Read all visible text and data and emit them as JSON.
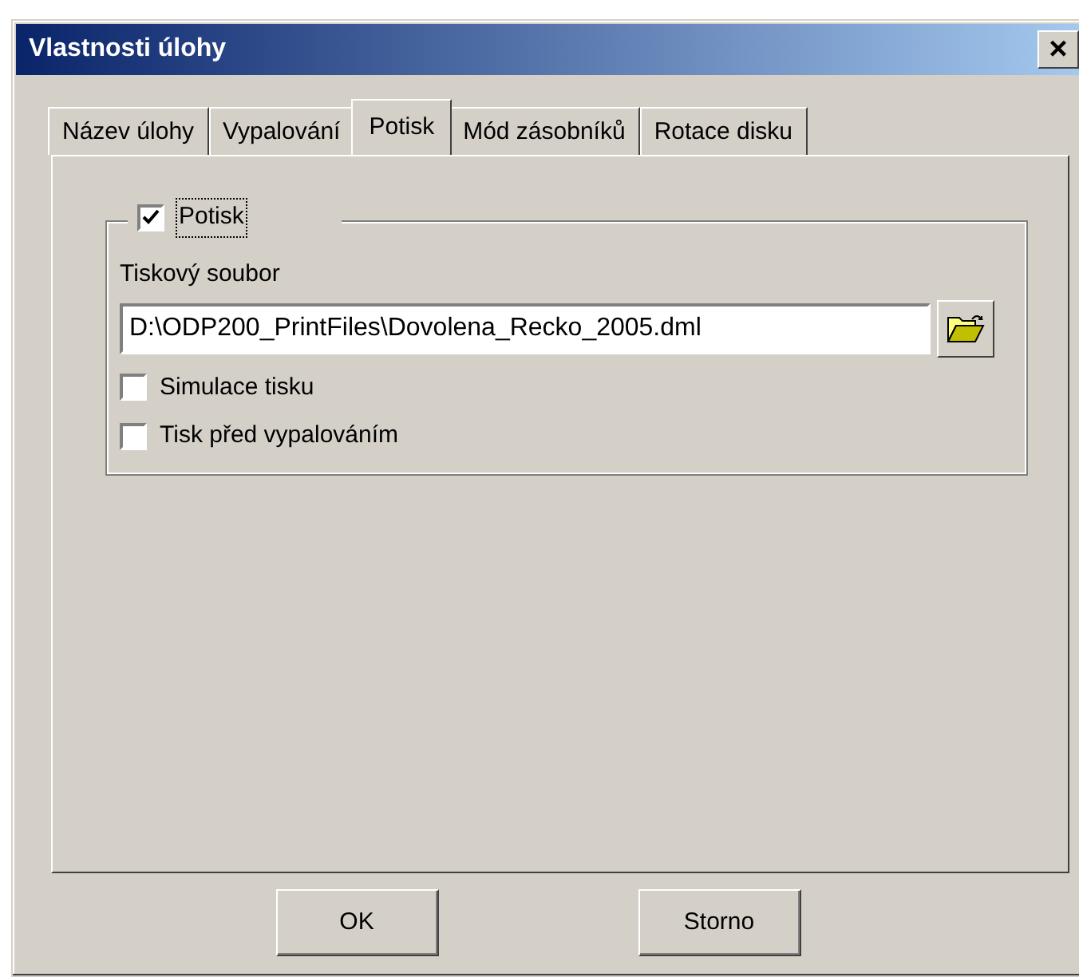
{
  "window": {
    "title": "Vlastnosti úlohy",
    "close_glyph": "×"
  },
  "tabs": [
    {
      "label": "Název úlohy",
      "selected": false
    },
    {
      "label": "Vypalování",
      "selected": false
    },
    {
      "label": "Potisk",
      "selected": true
    },
    {
      "label": "Mód zásobníků",
      "selected": false
    },
    {
      "label": "Rotace disku",
      "selected": false
    }
  ],
  "group": {
    "label": "Potisk",
    "checked": true
  },
  "file_label": "Tiskový soubor",
  "file_field": {
    "value": "D:\\ODP200_PrintFiles\\Dovolena_Recko_2005.dml"
  },
  "options": [
    {
      "label": "Simulace tisku",
      "checked": false
    },
    {
      "label": "Tisk před vypalováním",
      "checked": false
    }
  ],
  "buttons": [
    "OK",
    "Storno"
  ]
}
